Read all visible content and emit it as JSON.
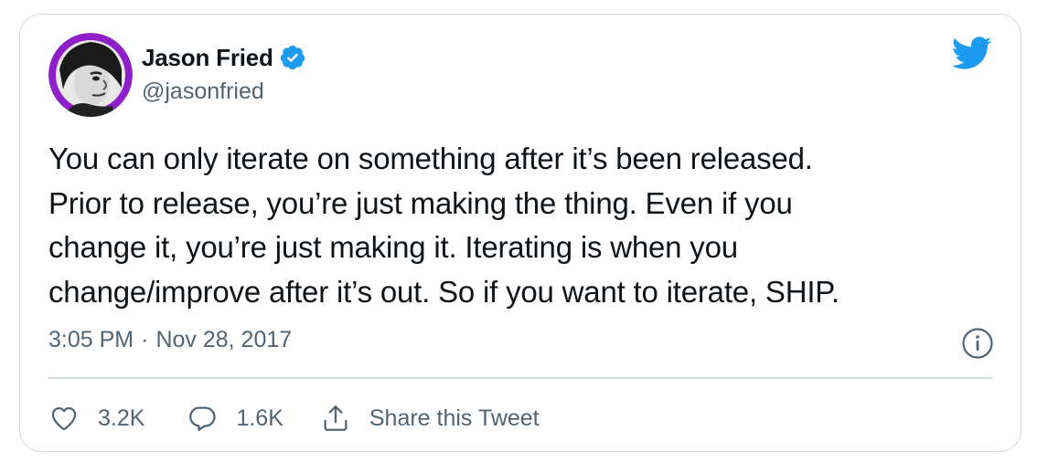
{
  "tweet": {
    "author": {
      "name": "Jason Fried",
      "handle": "@jasonfried",
      "verified": true
    },
    "text_lines": [
      "You can only iterate on something after it’s been released.",
      "Prior to release, you’re just making the thing. Even if you",
      "change it, you’re just making it. Iterating is when you",
      "change/improve after it’s out. So if you want to iterate, SHIP."
    ],
    "time": "3:05 PM",
    "separator": "·",
    "date": "Nov 28, 2017"
  },
  "actions": {
    "like_count": "3.2K",
    "reply_count": "1.6K",
    "share_label": "Share this Tweet"
  },
  "colors": {
    "twitter_blue": "#1d9bf0",
    "secondary_text": "#536471",
    "primary_text": "#0f1419",
    "border": "#cfd9de",
    "avatar_ring": "#8e1fc9"
  },
  "icons": [
    "avatar",
    "verified-badge-icon",
    "twitter-bird-icon",
    "info-icon",
    "heart-icon",
    "reply-bubble-icon",
    "share-icon"
  ]
}
